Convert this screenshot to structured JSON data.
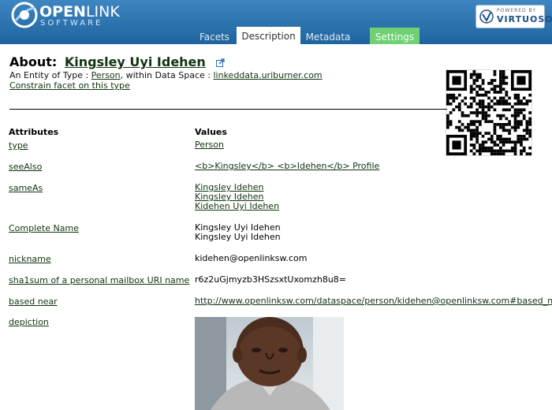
{
  "header": {
    "brand_open": "OPEN",
    "brand_link": "LINK",
    "brand_sub": "SOFTWARE",
    "powered_by": "POWERED BY",
    "virtuoso": "VIRTUOSO",
    "tabs": [
      {
        "label": "Facets"
      },
      {
        "label": "Description",
        "active": true
      },
      {
        "label": "Metadata"
      },
      {
        "label": "Settings"
      }
    ],
    "colors": {
      "header_bg": "#2b73b0",
      "settings_tab": "#70d074"
    }
  },
  "about": {
    "prefix": "About:",
    "name": "Kingsley Uyi Idehen",
    "entity_text": "An Entity of Type :",
    "entity_type": "Person",
    "within_text": ", within Data Space :",
    "data_space": "linkeddata.uriburner.com",
    "constrain": "Constrain facet on this type"
  },
  "table": {
    "col_attributes": "Attributes",
    "col_values": "Values",
    "rows": [
      {
        "prop": "type",
        "values": [
          "Person"
        ],
        "links": true
      },
      {
        "prop": "seeAlso",
        "values": [
          "<b>Kingsley</b> <b>Idehen</b> Profile"
        ],
        "links": true
      },
      {
        "prop": "sameAs",
        "values": [
          "Kingsley Idehen",
          "Kingsley Idehen",
          "Kidehen Uyi Idehen"
        ],
        "links": true
      },
      {
        "prop": "Complete Name",
        "values": [
          "Kingsley Uyi Idehen",
          "Kingsley Uyi Idehen"
        ],
        "links": false
      },
      {
        "prop": "nickname",
        "values": [
          "kidehen@openlinksw.com"
        ],
        "links": false
      },
      {
        "prop": "sha1sum of a personal mailbox URI name",
        "values": [
          "r6z2uGjmyzb3HSzsxtUxomzh8u8="
        ],
        "links": false
      },
      {
        "prop": "based near",
        "values": [
          "http://www.openlinksw.com/dataspace/person/kidehen@openlinksw.com#based_near"
        ],
        "links": true
      },
      {
        "prop": "depiction",
        "values": [],
        "links": false
      }
    ]
  }
}
